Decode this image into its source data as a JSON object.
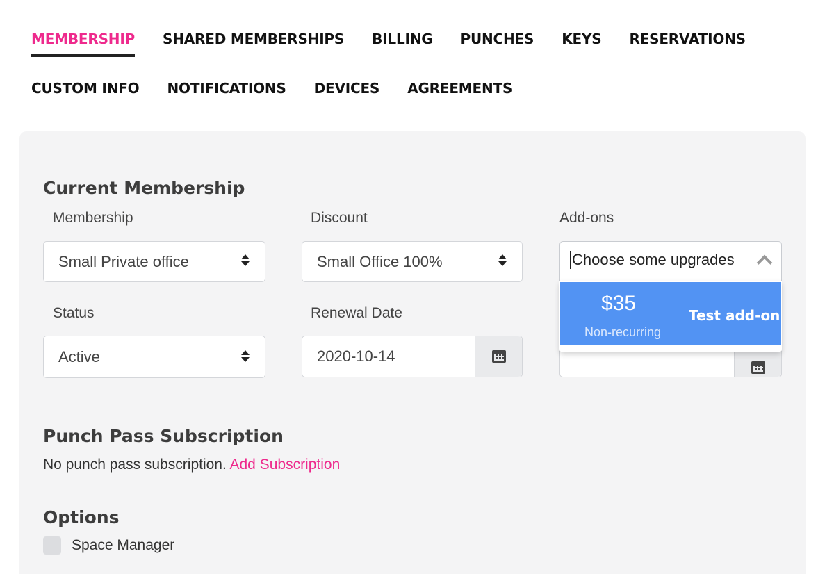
{
  "tabs_row1": [
    "MEMBERSHIP",
    "SHARED MEMBERSHIPS",
    "BILLING",
    "PUNCHES",
    "KEYS",
    "RESERVATIONS"
  ],
  "tabs_row2": [
    "CUSTOM INFO",
    "NOTIFICATIONS",
    "DEVICES",
    "AGREEMENTS"
  ],
  "active_tab": "MEMBERSHIP",
  "colors": {
    "accent": "#ee2a8d",
    "option_highlight": "#5293f3",
    "panel_bg": "#f4f4f5"
  },
  "current_membership": {
    "title": "Current Membership",
    "membership": {
      "label": "Membership",
      "value": "Small Private office"
    },
    "discount": {
      "label": "Discount",
      "value": "Small Office 100%"
    },
    "addons": {
      "label": "Add-ons",
      "placeholder": "Choose some upgrades",
      "options": [
        {
          "price": "$35",
          "recurrence": "Non-recurring",
          "name": "Test add-on f"
        }
      ]
    },
    "status": {
      "label": "Status",
      "value": "Active"
    },
    "renewal_date": {
      "label": "Renewal Date",
      "value": "2020-10-14"
    }
  },
  "punch_pass": {
    "title": "Punch Pass Subscription",
    "text": "No punch pass subscription.",
    "link": "Add Subscription"
  },
  "options": {
    "title": "Options",
    "space_manager_label": "Space Manager",
    "space_manager_checked": false
  }
}
